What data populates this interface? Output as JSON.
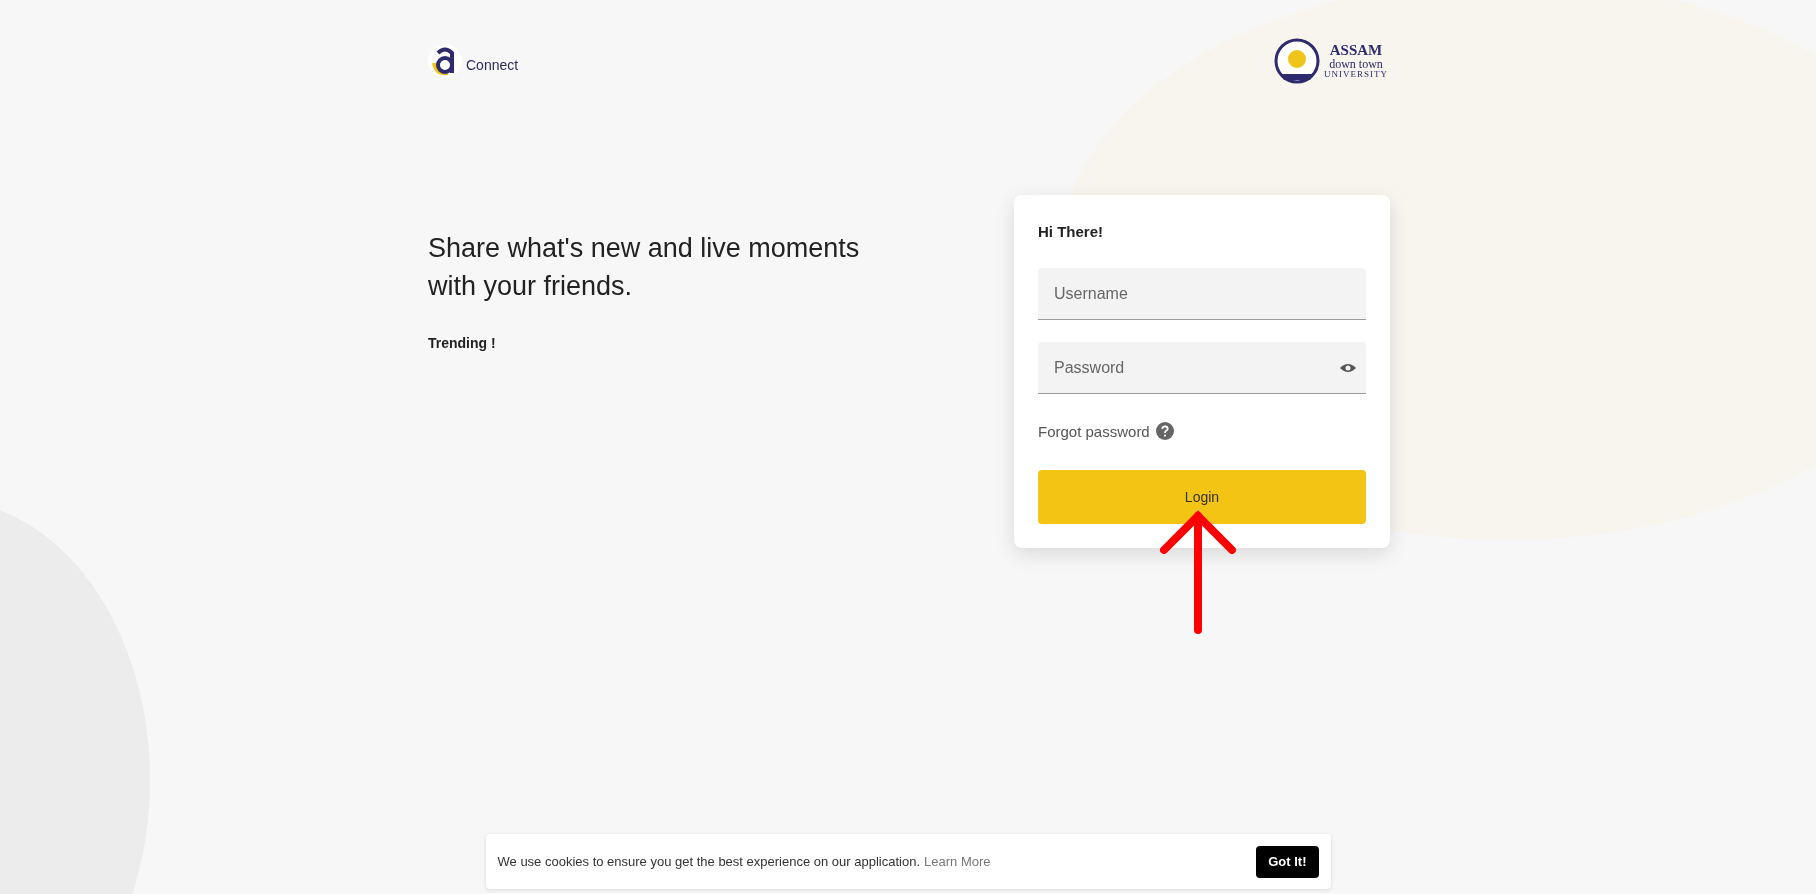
{
  "header": {
    "app_logo": {
      "text": "Connect"
    },
    "university_logo": {
      "lines": [
        "ASSAM",
        "down town",
        "UNIVERSITY"
      ]
    }
  },
  "hero": {
    "headline": "Share what's new and live moments with your friends.",
    "trending": "Trending !"
  },
  "login": {
    "greeting": "Hi There!",
    "username": {
      "placeholder": "Username"
    },
    "password": {
      "placeholder": "Password"
    },
    "forgot": "Forgot password",
    "button": "Login"
  },
  "cookie_bar": {
    "message": "We use cookies to ensure you get the best experience on our application.",
    "link": "Learn More",
    "button": "Got It!"
  }
}
